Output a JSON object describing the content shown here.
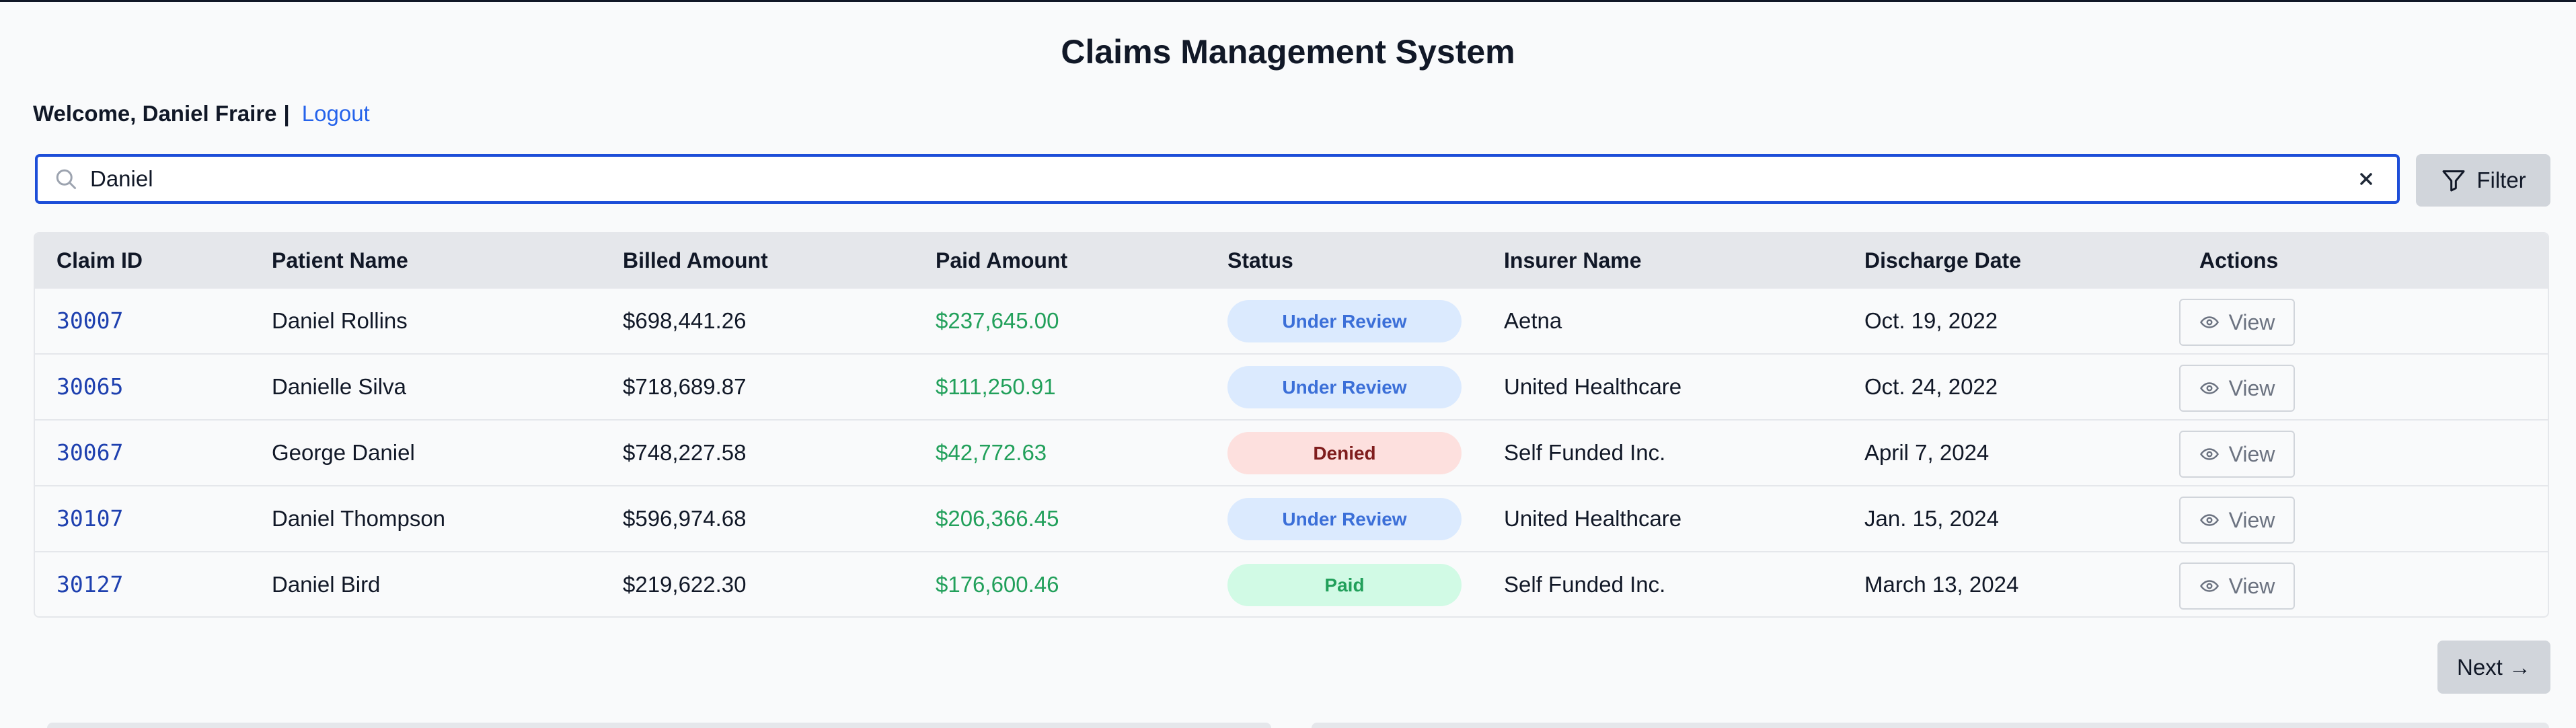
{
  "app": {
    "title": "Claims Management System"
  },
  "header": {
    "welcome": "Welcome, Daniel Fraire",
    "separator": "|",
    "logout": "Logout"
  },
  "search": {
    "value": "Daniel",
    "icon": "search-icon",
    "clear_icon": "close-icon"
  },
  "toolbar": {
    "filter_label": "Filter",
    "filter_icon": "funnel-icon"
  },
  "table": {
    "columns": [
      "Claim ID",
      "Patient Name",
      "Billed Amount",
      "Paid Amount",
      "Status",
      "Insurer Name",
      "Discharge Date",
      "Actions"
    ],
    "rows": [
      {
        "claim_id": "30007",
        "patient": "Daniel Rollins",
        "billed": "$698,441.26",
        "paid": "$237,645.00",
        "status": "Under Review",
        "insurer": "Aetna",
        "discharge": "Oct. 19, 2022",
        "action": "View"
      },
      {
        "claim_id": "30065",
        "patient": "Danielle Silva",
        "billed": "$718,689.87",
        "paid": "$111,250.91",
        "status": "Under Review",
        "insurer": "United Healthcare",
        "discharge": "Oct. 24, 2022",
        "action": "View"
      },
      {
        "claim_id": "30067",
        "patient": "George Daniel",
        "billed": "$748,227.58",
        "paid": "$42,772.63",
        "status": "Denied",
        "insurer": "Self Funded Inc.",
        "discharge": "April 7, 2024",
        "action": "View"
      },
      {
        "claim_id": "30107",
        "patient": "Daniel Thompson",
        "billed": "$596,974.68",
        "paid": "$206,366.45",
        "status": "Under Review",
        "insurer": "United Healthcare",
        "discharge": "Jan. 15, 2024",
        "action": "View"
      },
      {
        "claim_id": "30127",
        "patient": "Daniel Bird",
        "billed": "$219,622.30",
        "paid": "$176,600.46",
        "status": "Paid",
        "insurer": "Self Funded Inc.",
        "discharge": "March 13, 2024",
        "action": "View"
      }
    ]
  },
  "status_colors": {
    "Under Review": {
      "bg": "#dbeafe",
      "fg": "#3b6fd8"
    },
    "Denied": {
      "bg": "#fde0de",
      "fg": "#7f1d1d"
    },
    "Paid": {
      "bg": "#d1fae5",
      "fg": "#22a05b"
    }
  },
  "pagination": {
    "next_label": "Next →"
  },
  "colors": {
    "accent": "#2563eb",
    "link": "#1e40af",
    "paid_amount": "#22a05b"
  }
}
